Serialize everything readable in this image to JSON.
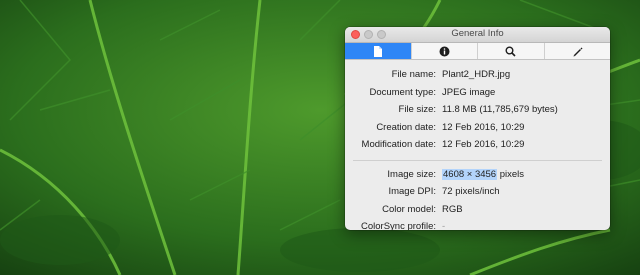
{
  "window": {
    "title": "General Info",
    "tabs": [
      {
        "icon": "document-icon",
        "active": true
      },
      {
        "icon": "info-icon",
        "active": false
      },
      {
        "icon": "search-icon",
        "active": false
      },
      {
        "icon": "pencil-icon",
        "active": false
      }
    ]
  },
  "file_info": {
    "file_name_label": "File name:",
    "file_name": "Plant2_HDR.jpg",
    "document_type_label": "Document type:",
    "document_type": "JPEG image",
    "file_size_label": "File size:",
    "file_size": "11.8 MB (11,785,679 bytes)",
    "creation_date_label": "Creation date:",
    "creation_date": "12 Feb 2016, 10:29",
    "modification_date_label": "Modification date:",
    "modification_date": "12 Feb 2016, 10:29"
  },
  "image_info": {
    "image_size_label": "Image size:",
    "image_size_selected": "4608 × 3456",
    "image_size_unit": " pixels",
    "image_dpi_label": "Image DPI:",
    "image_dpi": "72 pixels/inch",
    "color_model_label": "Color model:",
    "color_model": "RGB",
    "colorsync_label": "ColorSync profile:",
    "colorsync": "-"
  },
  "colors": {
    "accent": "#2e86f6",
    "selection": "#b3d4fb",
    "close_button": "#fc605c"
  }
}
